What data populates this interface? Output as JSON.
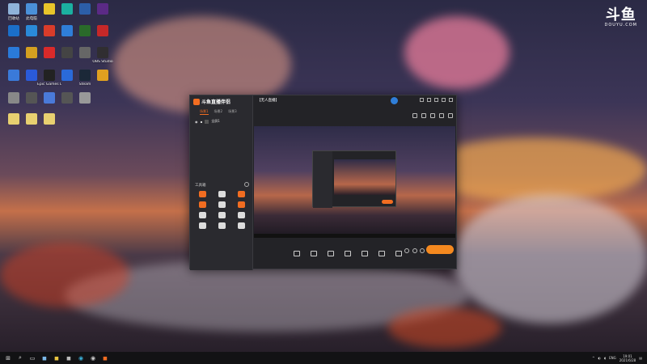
{
  "watermark": {
    "brand": "斗鱼",
    "domain": "DOUYU.COM"
  },
  "desktop_icons": [
    {
      "label": "回收站",
      "color": "#8fb3d9",
      "icon": "recycle-bin-icon"
    },
    {
      "label": "此电脑",
      "color": "#4a90d9",
      "icon": "computer-icon"
    },
    {
      "label": "",
      "color": "#e8c52a",
      "icon": "app-icon"
    },
    {
      "label": "",
      "color": "#1bb0a0",
      "icon": "app-icon"
    },
    {
      "label": "",
      "color": "#2c5ea8",
      "icon": "photoshop-icon"
    },
    {
      "label": "",
      "color": "#5b2a86",
      "icon": "premiere-icon"
    },
    {
      "label": "",
      "color": "#1b6fc9",
      "icon": "app-icon"
    },
    {
      "label": "",
      "color": "#2a8ad9",
      "icon": "app-icon"
    },
    {
      "label": "",
      "color": "#d93c2a",
      "icon": "app-icon"
    },
    {
      "label": "",
      "color": "#2f7ed8",
      "icon": "edge-icon"
    },
    {
      "label": "",
      "color": "#2a6a2a",
      "icon": "app-icon"
    },
    {
      "label": "",
      "color": "#c62828",
      "icon": "app-icon"
    },
    {
      "label": "",
      "color": "#2a7ad9",
      "icon": "app-icon"
    },
    {
      "label": "",
      "color": "#d4a020",
      "icon": "app-icon"
    },
    {
      "label": "",
      "color": "#d92a2a",
      "icon": "app-icon"
    },
    {
      "label": "",
      "color": "#444",
      "icon": "qq-icon"
    },
    {
      "label": "",
      "color": "#666",
      "icon": "app-icon"
    },
    {
      "label": "OBS Studio",
      "color": "#302e31",
      "icon": "obs-icon"
    },
    {
      "label": "",
      "color": "#3a7ad9",
      "icon": "app-icon"
    },
    {
      "label": "",
      "color": "#2a5ad9",
      "icon": "app-icon"
    },
    {
      "label": "Epic Games Launcher",
      "color": "#222",
      "icon": "epic-icon"
    },
    {
      "label": "",
      "color": "#2a6ad9",
      "icon": "app-icon"
    },
    {
      "label": "Steam",
      "color": "#1b2838",
      "icon": "steam-icon"
    },
    {
      "label": "",
      "color": "#e0a020",
      "icon": "app-icon"
    },
    {
      "label": "",
      "color": "#888",
      "icon": "app-icon"
    },
    {
      "label": "",
      "color": "#555",
      "icon": "app-icon"
    },
    {
      "label": "",
      "color": "#4a7ad9",
      "icon": "app-icon"
    },
    {
      "label": "",
      "color": "#555",
      "icon": "app-icon"
    },
    {
      "label": "",
      "color": "#999",
      "icon": "app-icon"
    },
    {
      "label": "",
      "color": "#e8d070",
      "icon": "folder-icon"
    },
    {
      "label": "",
      "color": "#e8d070",
      "icon": "folder-icon"
    },
    {
      "label": "",
      "color": "#e8d070",
      "icon": "folder-icon"
    }
  ],
  "app": {
    "logo": "斗鱼直播伴侣",
    "scene_tabs": [
      "场景1",
      "场景2",
      "场景3"
    ],
    "scene_row": "全屏1",
    "tools_title": "工具箱",
    "tools": [
      {
        "label": "",
        "hot": true
      },
      {
        "label": "",
        "hot": false
      },
      {
        "label": "",
        "hot": true
      },
      {
        "label": "",
        "hot": true
      },
      {
        "label": "",
        "hot": false
      },
      {
        "label": "",
        "hot": true
      },
      {
        "label": "",
        "hot": false
      },
      {
        "label": "",
        "hot": false
      },
      {
        "label": "",
        "hot": false
      },
      {
        "label": "",
        "hot": false
      },
      {
        "label": "",
        "hot": false
      },
      {
        "label": "",
        "hot": false
      }
    ],
    "room_title": "【无人直播】",
    "room_badge": "",
    "bottom_items": [
      "",
      "",
      "",
      "",
      "",
      "",
      ""
    ],
    "live_button": ""
  },
  "taskbar": {
    "time": "19:01",
    "date": "2021/6/28",
    "lang": "ENG"
  }
}
